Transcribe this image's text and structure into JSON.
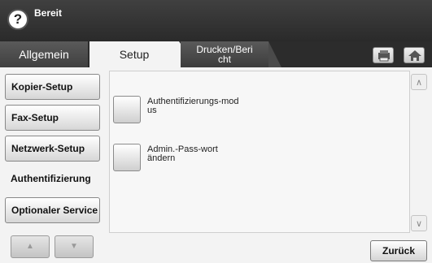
{
  "header": {
    "help_icon": "?",
    "status": "Bereit"
  },
  "tabs": [
    {
      "label": "Allgemein"
    },
    {
      "label": "Setup"
    },
    {
      "label_line1": "Drucken/Beri",
      "label_line2": "cht"
    }
  ],
  "toolbar_icons": [
    "print-icon",
    "home-icon"
  ],
  "sidebar": {
    "items": [
      {
        "label": "Kopier-Setup"
      },
      {
        "label": "Fax-Setup"
      },
      {
        "label": "Netzwerk-Setup"
      },
      {
        "label": "Authentifizierung",
        "selected": true
      },
      {
        "label": "Optionaler Service"
      }
    ],
    "scroll_up": "▲",
    "scroll_down": "▼"
  },
  "main": {
    "options": [
      {
        "line1": "Authentifizierungs-mod",
        "line2": "us"
      },
      {
        "line1": "Admin.-Pass-wort",
        "line2": "ändern"
      }
    ],
    "scroll_up": "∧",
    "scroll_down": "∨",
    "back_label": "Zurück"
  }
}
